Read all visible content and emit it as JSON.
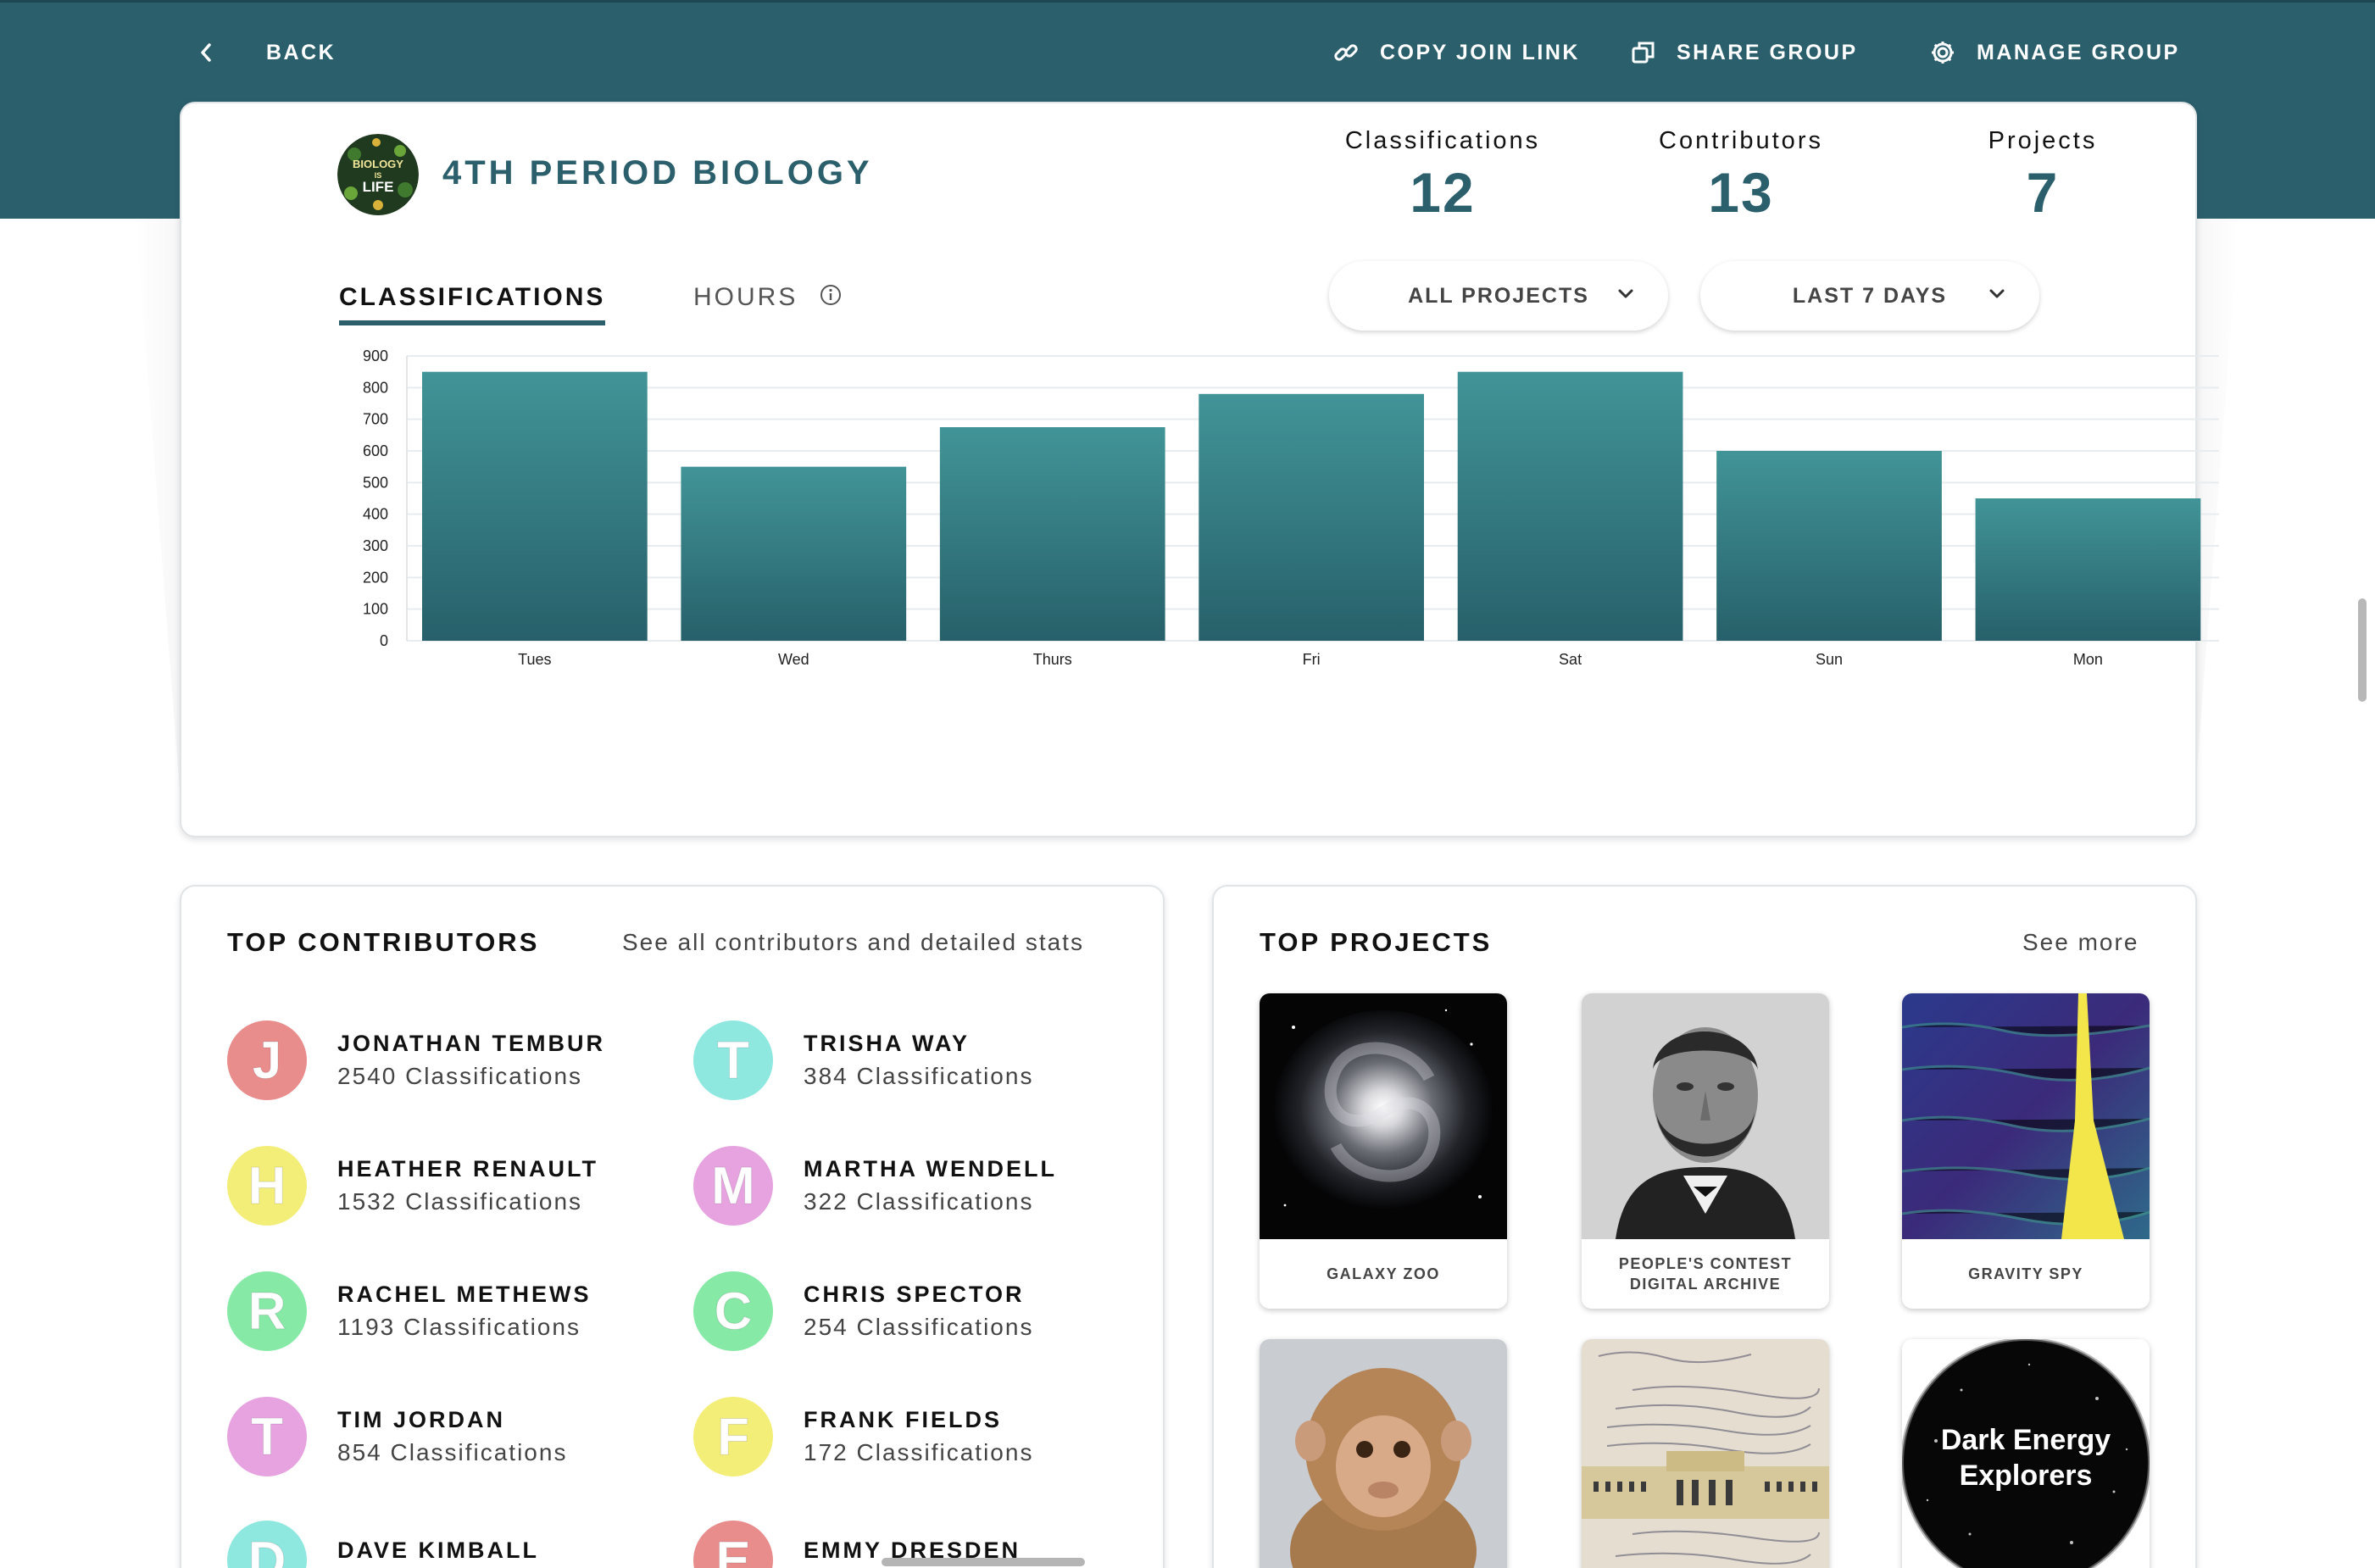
{
  "topbar": {
    "back_label": "BACK",
    "copy_link_label": "COPY JOIN LINK",
    "share_label": "SHARE GROUP",
    "manage_label": "MANAGE GROUP"
  },
  "group": {
    "title": "4TH PERIOD BIOLOGY",
    "logo_lines": [
      "BIOLOGY",
      "IS",
      "LIFE"
    ]
  },
  "stats": [
    {
      "label": "Classifications",
      "value": "12"
    },
    {
      "label": "Contributors",
      "value": "13"
    },
    {
      "label": "Projects",
      "value": "7"
    }
  ],
  "tabs": {
    "classifications": "CLASSIFICATIONS",
    "hours": "HOURS"
  },
  "filters": {
    "projects": "ALL PROJECTS",
    "range": "LAST 7 DAYS"
  },
  "chart_data": {
    "type": "bar",
    "categories": [
      "Tues",
      "Wed",
      "Thurs",
      "Fri",
      "Sat",
      "Sun",
      "Mon"
    ],
    "values": [
      850,
      550,
      675,
      780,
      850,
      600,
      450
    ],
    "yticks": [
      0,
      100,
      200,
      300,
      400,
      500,
      600,
      700,
      800,
      900
    ],
    "ylim": [
      0,
      900
    ],
    "title": "",
    "xlabel": "",
    "ylabel": "",
    "grid": true,
    "bar_color_top": "#419497",
    "bar_color_bottom": "#27606a"
  },
  "contributors": {
    "title": "TOP CONTRIBUTORS",
    "link": "See all contributors and detailed stats",
    "people": [
      {
        "initial": "J",
        "name": "JONATHAN TEMBUR",
        "count": "2540 Classifications",
        "color": "#e88c8c"
      },
      {
        "initial": "T",
        "name": "TRISHA WAY",
        "count": "384 Classifications",
        "color": "#8ee8e0"
      },
      {
        "initial": "H",
        "name": "HEATHER RENAULT",
        "count": "1532 Classifications",
        "color": "#f3ee78"
      },
      {
        "initial": "M",
        "name": "MARTHA WENDELL",
        "count": "322 Classifications",
        "color": "#e6a3e0"
      },
      {
        "initial": "R",
        "name": "RACHEL METHEWS",
        "count": "1193 Classifications",
        "color": "#86e9a6"
      },
      {
        "initial": "C",
        "name": "CHRIS SPECTOR",
        "count": "254 Classifications",
        "color": "#86e9a6"
      },
      {
        "initial": "T",
        "name": "TIM JORDAN",
        "count": "854 Classifications",
        "color": "#e6a3e0"
      },
      {
        "initial": "F",
        "name": "FRANK FIELDS",
        "count": "172 Classifications",
        "color": "#f3ee78"
      },
      {
        "initial": "D",
        "name": "DAVE KIMBALL",
        "count": "",
        "color": "#8ee8e0"
      },
      {
        "initial": "E",
        "name": "EMMY DRESDEN",
        "count": "",
        "color": "#e88c8c"
      }
    ]
  },
  "projects": {
    "title": "TOP PROJECTS",
    "link": "See more",
    "items": [
      {
        "label": "GALAXY ZOO"
      },
      {
        "label": "PEOPLE'S CONTEST DIGITAL ARCHIVE"
      },
      {
        "label": "GRAVITY SPY"
      },
      {
        "label": ""
      },
      {
        "label": ""
      },
      {
        "label": "",
        "art_text": [
          "Dark Energy",
          "Explorers"
        ]
      }
    ]
  }
}
